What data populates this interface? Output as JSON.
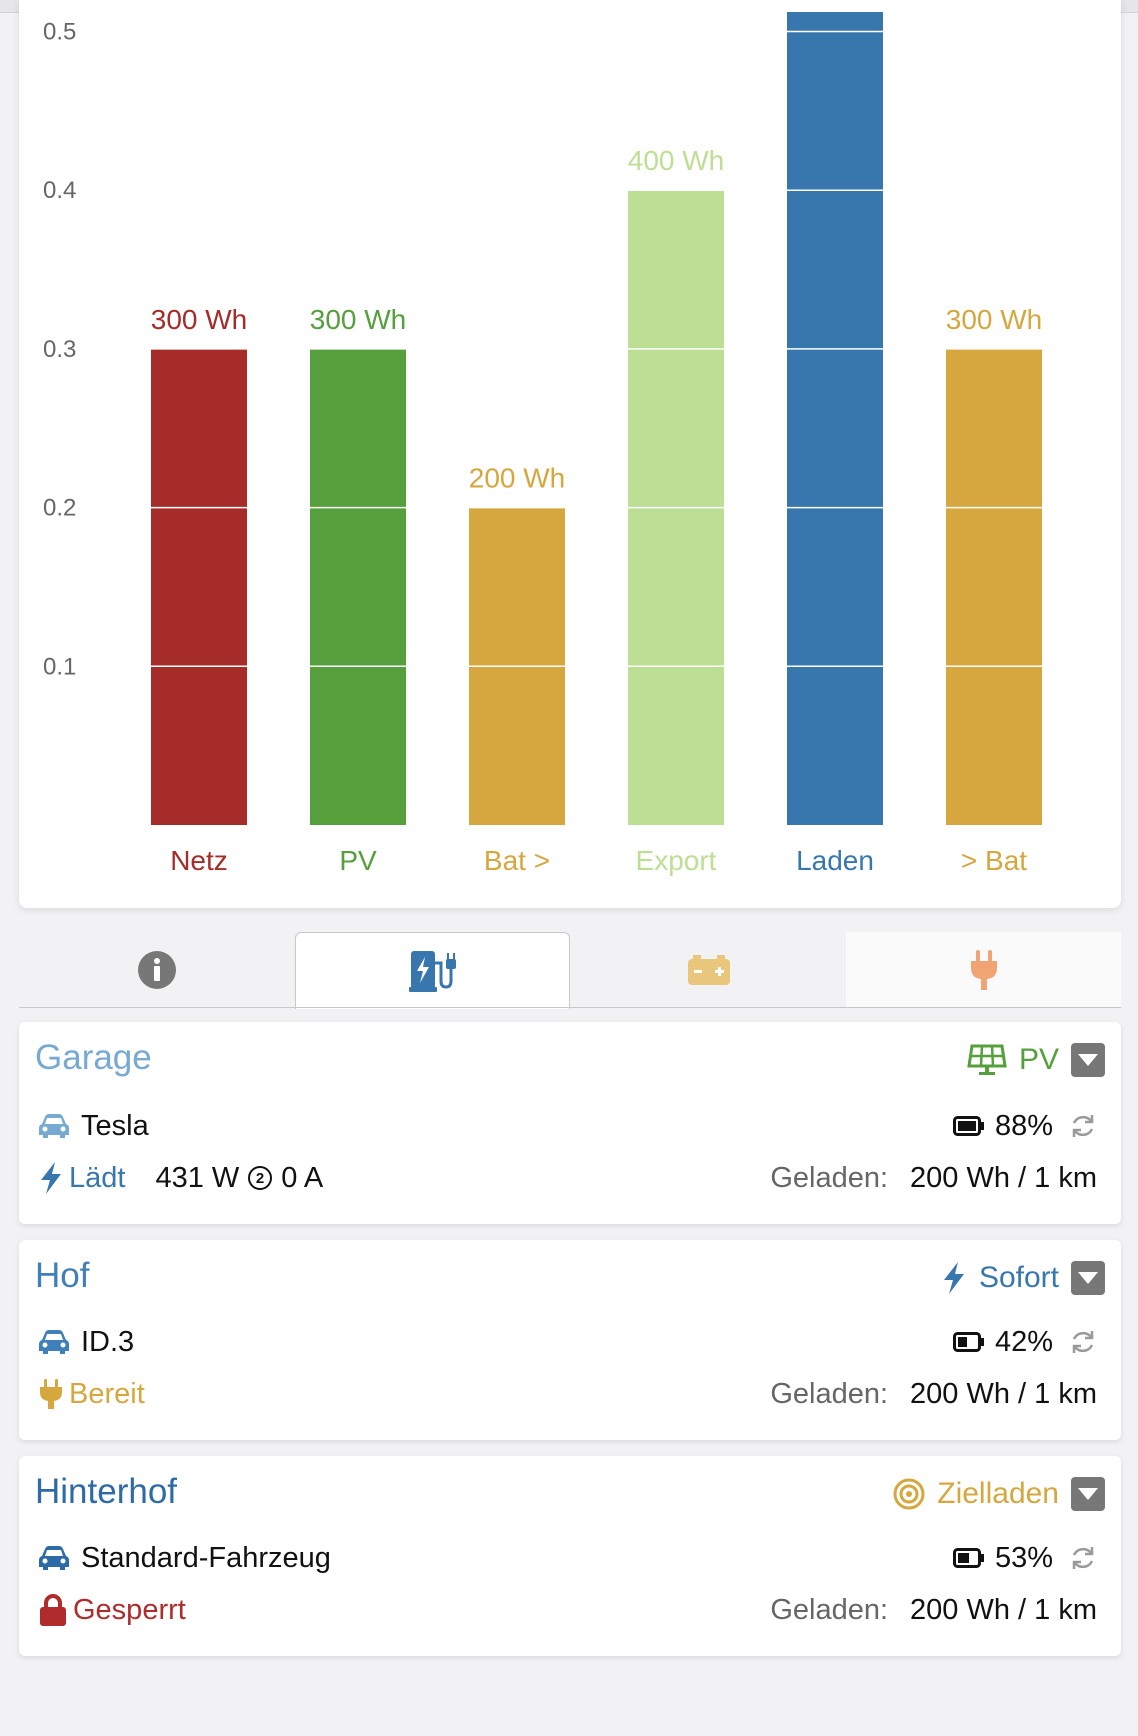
{
  "colors": {
    "netz": "#a52c28",
    "pv": "#55a03c",
    "bat": "#d6a73e",
    "export": "#bddf94",
    "laden": "#3877ae",
    "axis_text": "#666666",
    "grey_icon": "#777777",
    "garage_title": "#77aad2",
    "hof_title": "#3f7fba",
    "hinterhof_title": "#2d6aa6",
    "locked": "#b02c2c"
  },
  "chart_data": {
    "type": "bar",
    "categories": [
      "Netz",
      "PV",
      "Bat >",
      "Export",
      "Laden",
      "> Bat"
    ],
    "values": [
      0.3,
      0.3,
      0.2,
      0.4,
      0.6,
      0.3
    ],
    "data_labels": [
      "300 Wh",
      "300 Wh",
      "200 Wh",
      "400 Wh",
      "",
      "300 Wh"
    ],
    "bar_colors": [
      "#a52c28",
      "#55a03c",
      "#d6a73e",
      "#bddf94",
      "#3877ae",
      "#d6a73e"
    ],
    "y_ticks": [
      0.1,
      0.2,
      0.3,
      0.4,
      0.5
    ],
    "y_tick_labels": [
      "0.1",
      "0.2",
      "0.3",
      "0.4",
      "0.5"
    ],
    "ylim": [
      0,
      0.5
    ],
    "grid": true
  },
  "tabs": [
    {
      "icon": "info-icon",
      "active": false
    },
    {
      "icon": "charging-station-icon",
      "active": true
    },
    {
      "icon": "battery-icon",
      "active": false
    },
    {
      "icon": "plug-icon",
      "active": false
    }
  ],
  "loadpoints": [
    {
      "title": "Garage",
      "mode_icon": "solar-panel-icon",
      "mode": "PV",
      "vehicle": "Tesla",
      "soc": "88%",
      "status": "Lädt",
      "power": "431 W",
      "phases": "2",
      "current": "0 A",
      "charged_label": "Geladen:",
      "charged_value": "200 Wh / 1 km"
    },
    {
      "title": "Hof",
      "mode_icon": "lightning-icon",
      "mode": "Sofort",
      "vehicle": "ID.3",
      "soc": "42%",
      "status": "Bereit",
      "charged_label": "Geladen:",
      "charged_value": "200 Wh / 1 km"
    },
    {
      "title": "Hinterhof",
      "mode_icon": "target-icon",
      "mode": "Zielladen",
      "vehicle": "Standard-Fahrzeug",
      "soc": "53%",
      "status": "Gesperrt",
      "charged_label": "Geladen:",
      "charged_value": "200 Wh / 1 km"
    }
  ]
}
